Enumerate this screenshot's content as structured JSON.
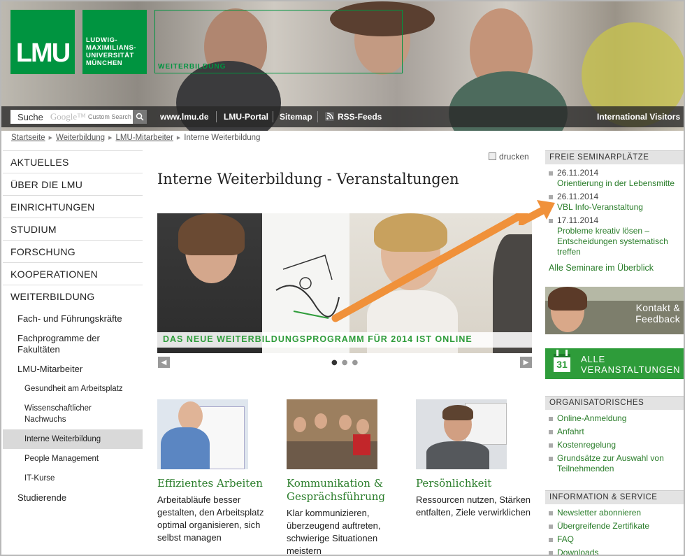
{
  "header": {
    "logo_letters": "LMU",
    "logo_lines": [
      "LUDWIG-",
      "MAXIMILIANS-",
      "UNIVERSITÄT",
      "MÜNCHEN"
    ],
    "section_label": "WEITERBILDUNG",
    "brand_color": "#009440"
  },
  "topbar": {
    "search_label": "Suche",
    "search_google": "Google™",
    "search_custom": "Custom Search",
    "links": [
      "www.lmu.de",
      "LMU-Portal",
      "Sitemap",
      "RSS-Feeds"
    ],
    "international": "International Visitors"
  },
  "breadcrumb": [
    "Startseite",
    "Weiterbildung",
    "LMU-Mitarbeiter",
    "Interne Weiterbildung"
  ],
  "nav": {
    "main": [
      "AKTUELLES",
      "ÜBER DIE LMU",
      "EINRICHTUNGEN",
      "STUDIUM",
      "FORSCHUNG",
      "KOOPERATIONEN",
      "WEITERBILDUNG"
    ],
    "sub": [
      "Fach- und Führungskräfte",
      "Fachprogramme der Fakultäten",
      "LMU-Mitarbeiter"
    ],
    "sub3": [
      "Gesundheit am Arbeitsplatz",
      "Wissenschaftlicher Nachwuchs",
      "Interne Weiterbildung",
      "People Management",
      "IT-Kurse"
    ],
    "studierende": "Studierende"
  },
  "main": {
    "print": "drucken",
    "title": "Interne Weiterbildung - Veranstaltungen",
    "teaser_caption": "DAS NEUE WEITERBILDUNGSPROGRAMM FÜR 2014 IST ONLINE",
    "cards": [
      {
        "title": "Effizientes Arbeiten",
        "text": "Arbeitabläufe besser gestalten, den Arbeitsplatz optimal organisieren, sich selbst managen"
      },
      {
        "title": "Kommunikation & Gesprächsführung",
        "text": "Klar kommunizieren, überzeugend auftreten, schwierige Situationen meistern"
      },
      {
        "title": "Persönlichkeit",
        "text": "Ressourcen nutzen, Stärken entfalten, Ziele verwirklichen"
      }
    ]
  },
  "right": {
    "seminar_head": "FREIE SEMINARPLÄTZE",
    "seminars": [
      {
        "date": "26.11.2014",
        "title": "Orientierung in der Lebensmitte"
      },
      {
        "date": "26.11.2014",
        "title": "VBL Info-Veranstaltung"
      },
      {
        "date": "17.11.2014",
        "title": "Probleme kreativ lösen – Entscheidungen systematisch treffen"
      }
    ],
    "all_seminars": "Alle Seminare im Überblick",
    "contact": "Kontakt & Feedback",
    "calendar_day": "31",
    "all_events": "ALLE VERANSTALTUNGEN",
    "org_head": "ORGANISATORISCHES",
    "org_links": [
      "Online-Anmeldung",
      "Anfahrt",
      "Kostenregelung",
      "Grundsätze zur Auswahl von Teilnehmenden"
    ],
    "info_head": "INFORMATION & SERVICE",
    "info_links": [
      "Newsletter abonnieren",
      "Übergreifende Zertifikate",
      "FAQ",
      "Downloads"
    ]
  },
  "colors": {
    "green_link": "#2a7d2a",
    "accent_green": "#2e9c3a",
    "arrow_orange": "#f0913a"
  }
}
